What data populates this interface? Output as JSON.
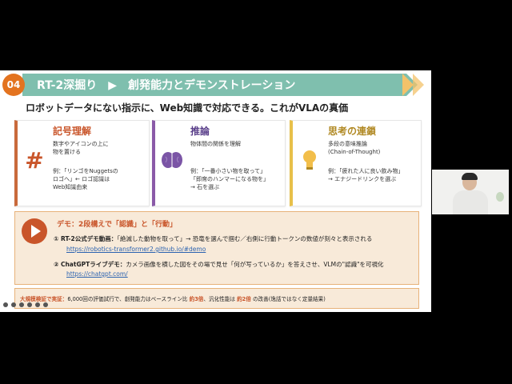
{
  "header": {
    "number": "04",
    "title": "RT-2深掘り　▶　創発能力とデモンストレーション"
  },
  "tagline": "ロボットデータにない指示に、Web知識で対応できる。これがVLAの真価",
  "cards": [
    {
      "title": "記号理解",
      "icon": "hash-icon",
      "desc": "数字やアイコンの上に\n物を置ける",
      "example": "例：「リンゴをNuggetsの\nロゴへ」← ロゴ認識は\nWeb知識由来"
    },
    {
      "title": "推論",
      "icon": "brain-icon",
      "desc": "物体間の関係を理解",
      "example": "例：「一番小さい物を取って」\n「即席のハンマーになる物を」\n→ 石を選ぶ"
    },
    {
      "title": "思考の連鎖",
      "icon": "lightbulb-icon",
      "desc": "多段の意味推論\n(Chain-of-Thought)",
      "example": "例：「疲れた人に良い飲み物」\n→ エナジードリンクを選ぶ"
    }
  ],
  "demo": {
    "title": "デモ：2段構えで「認識」と「行動」",
    "item1_label": "① RT-2公式デモ動画：",
    "item1_text": "「絶滅した動物を取って」→ 恐竜を選んで掴む／右側に行動トークンの数値が刻々と表示される",
    "item1_link": "https://robotics-transformer2.github.io/#demo",
    "item2_label": "② ChatGPTライブデモ：",
    "item2_text": "カメラ画像を横した図をその場で見せ「何が写っているか」を答えさせ、VLMの\"認識\"を可視化",
    "item2_link": "https://chatgpt.com/"
  },
  "bottom": {
    "label": "大規模検証で実証：",
    "text1": "6,000回の評価試行で、創発能力はベースライン比",
    "v1": "約3倍",
    "text2": "、汎化性能は",
    "v2": "約2倍",
    "text3": "の改善(逸話ではなく定量結果)"
  },
  "colors": {
    "accent": "#e3731f",
    "header": "#7fbfae",
    "demo_bg": "#f8ead9"
  }
}
